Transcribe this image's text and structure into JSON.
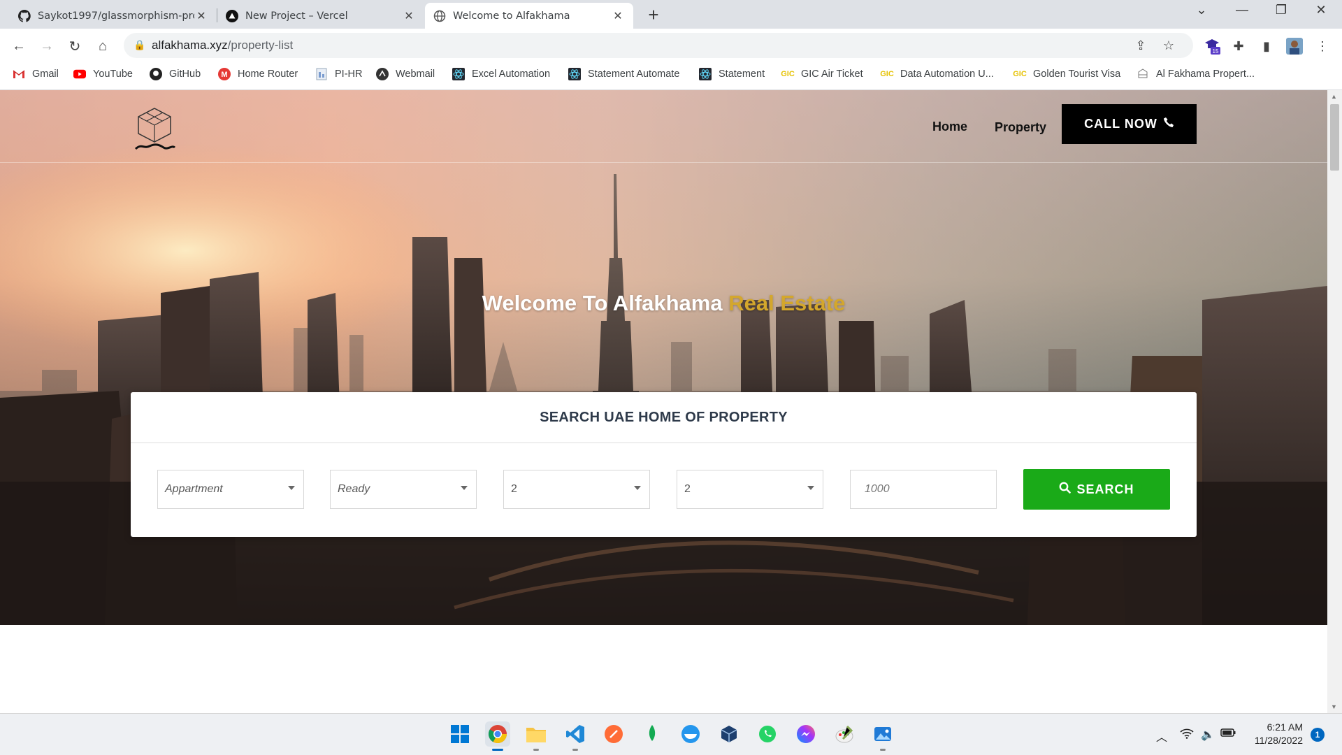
{
  "browser": {
    "tabs": [
      {
        "title": "Saykot1997/glassmorphism-prot",
        "favicon": "github-icon",
        "active": false
      },
      {
        "title": "New Project – Vercel",
        "favicon": "vercel-icon",
        "active": false
      },
      {
        "title": "Welcome to Alfakhama",
        "favicon": "globe-icon",
        "active": true
      }
    ],
    "url_host": "alfakhama.xyz",
    "url_path": "/property-list",
    "profile_badge": "15",
    "bookmarks": [
      {
        "label": "Gmail",
        "icon": "gmail-icon"
      },
      {
        "label": "YouTube",
        "icon": "youtube-icon"
      },
      {
        "label": "GitHub",
        "icon": "github-icon"
      },
      {
        "label": "Home Router",
        "icon": "router-icon"
      },
      {
        "label": "PI-HR",
        "icon": "document-icon"
      },
      {
        "label": "Webmail",
        "icon": "webmail-icon"
      },
      {
        "label": "Excel Automation",
        "icon": "react-icon"
      },
      {
        "label": "Statement Automate",
        "icon": "react-icon"
      },
      {
        "label": "Statement",
        "icon": "react-icon"
      },
      {
        "label": "GIC Air Ticket",
        "icon": "gic-icon"
      },
      {
        "label": "Data Automation U...",
        "icon": "gic-icon"
      },
      {
        "label": "Golden Tourist Visa",
        "icon": "gic-icon"
      },
      {
        "label": "Al Fakhama Propert...",
        "icon": "alfakhama-icon"
      }
    ]
  },
  "site": {
    "nav": {
      "home": "Home",
      "property": "Property",
      "call": "CALL NOW"
    },
    "hero": {
      "title_main": "Welcome To Alfakhama ",
      "title_accent": "Real Estate",
      "accent_color": "#d4a72c"
    },
    "search": {
      "title": "SEARCH UAE HOME OF PROPERTY",
      "type": "Appartment",
      "status": "Ready",
      "bedrooms": "2",
      "bathrooms": "2",
      "price_placeholder": "1000",
      "button": "SEARCH",
      "button_color": "#1aaa18"
    }
  },
  "taskbar": {
    "apps": [
      "windows-start-icon",
      "chrome-icon",
      "file-explorer-icon",
      "vscode-icon",
      "postman-icon",
      "mongodb-icon",
      "docker-icon",
      "virtualbox-icon",
      "whatsapp-icon",
      "messenger-icon",
      "paint-icon",
      "photos-icon"
    ],
    "time": "6:21 AM",
    "date": "11/28/2022",
    "notifications": "1"
  }
}
